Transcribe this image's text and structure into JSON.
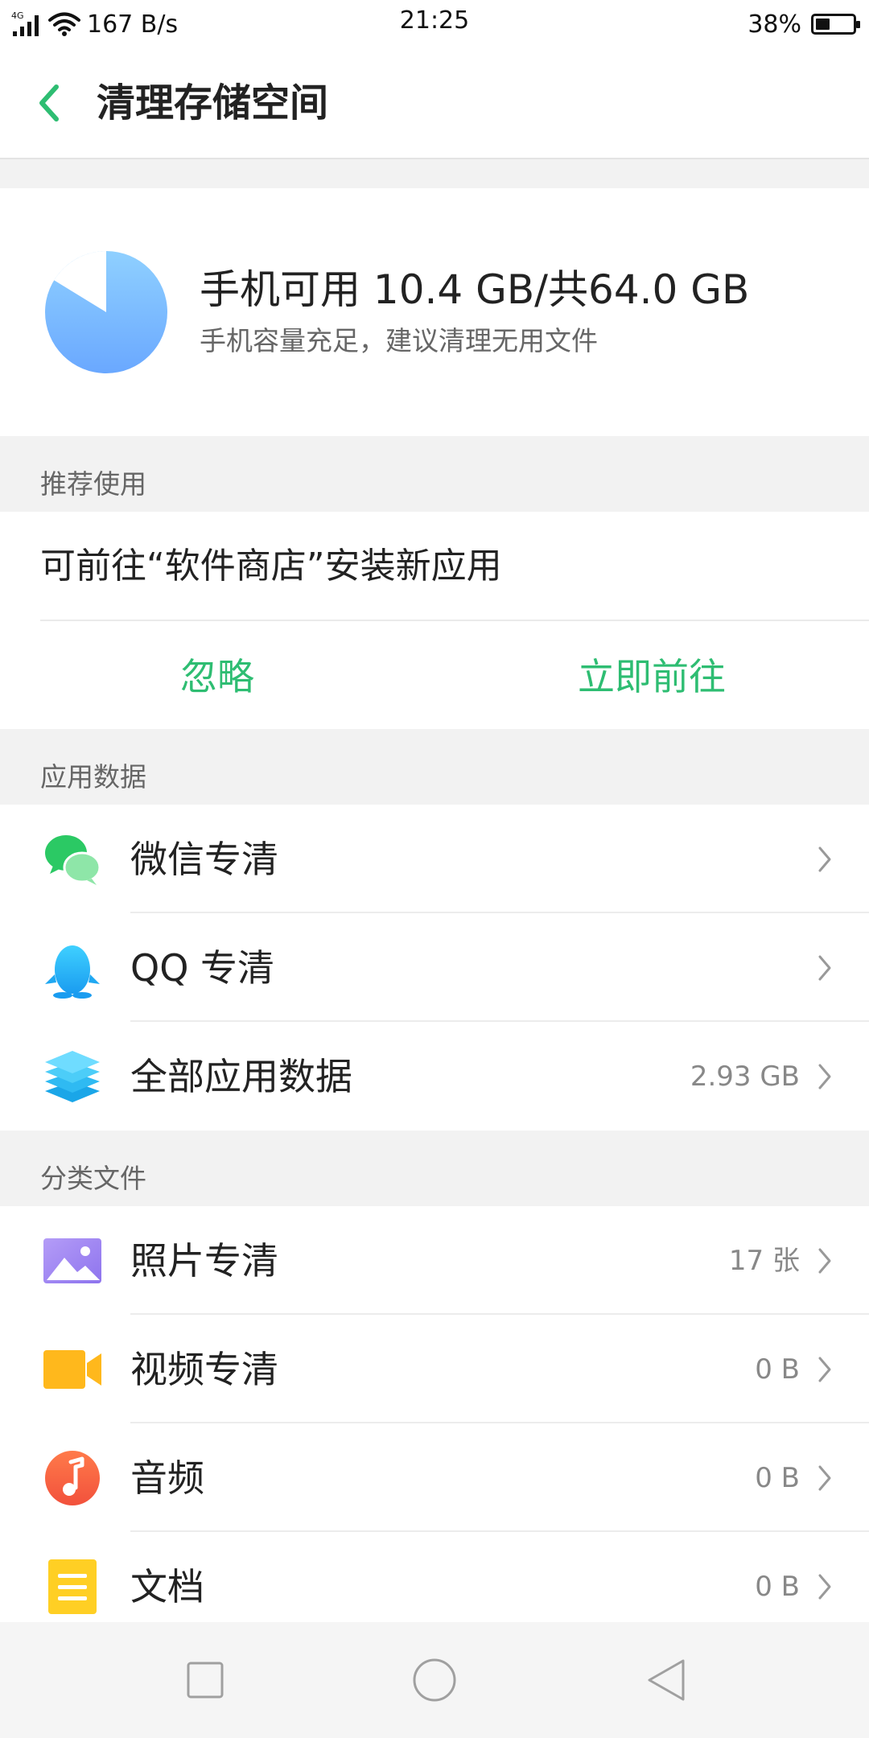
{
  "status_bar": {
    "network_type": "4G",
    "speed": "167 B/s",
    "time": "21:25",
    "battery_percent": "38%",
    "battery_level": 0.38
  },
  "header": {
    "title": "清理存储空间",
    "back_icon": "chevron-left-icon"
  },
  "storage": {
    "summary": "手机可用 10.4 GB/共64.0 GB",
    "subtitle": "手机容量充足，建议清理无用文件",
    "available_gb": 10.4,
    "total_gb": 64.0
  },
  "recommend": {
    "section_label": "推荐使用",
    "text": "可前往“软件商店”安装新应用",
    "ignore_label": "忽略",
    "go_label": "立即前往"
  },
  "app_data": {
    "section_label": "应用数据",
    "items": [
      {
        "label": "微信专清",
        "value": "",
        "icon": "wechat-icon"
      },
      {
        "label": "QQ 专清",
        "value": "",
        "icon": "qq-penguin-icon"
      },
      {
        "label": "全部应用数据",
        "value": "2.93 GB",
        "icon": "layers-icon"
      }
    ]
  },
  "category_files": {
    "section_label": "分类文件",
    "items": [
      {
        "label": "照片专清",
        "value": "17 张",
        "icon": "photo-icon"
      },
      {
        "label": "视频专清",
        "value": "0 B",
        "icon": "video-camera-icon"
      },
      {
        "label": "音频",
        "value": "0 B",
        "icon": "music-note-icon"
      },
      {
        "label": "文档",
        "value": "0 B",
        "icon": "document-icon"
      }
    ]
  },
  "colors": {
    "accent_green": "#2ebd72",
    "pie_blue": "#7fb6ff",
    "text_primary": "#222222",
    "text_secondary": "#666666",
    "background": "#f2f2f2"
  }
}
